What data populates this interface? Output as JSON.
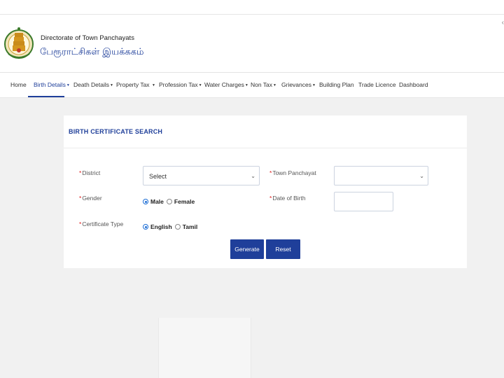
{
  "header": {
    "org_name_en": "Directorate of Town Panchayats",
    "org_name_ta": "பேரூராட்சிகள் இயக்ககம்",
    "corner_glyph": "‹"
  },
  "nav": {
    "items": [
      {
        "label": "Home",
        "dropdown": false
      },
      {
        "label": "Birth Details",
        "dropdown": true,
        "active": true
      },
      {
        "label": "Death Details",
        "dropdown": true
      },
      {
        "label": "Property Tax",
        "dropdown": true
      },
      {
        "label": "Profession Tax",
        "dropdown": true
      },
      {
        "label": "Water Charges",
        "dropdown": true
      },
      {
        "label": "Non Tax",
        "dropdown": true
      },
      {
        "label": "Grievances",
        "dropdown": true
      },
      {
        "label": "Building Plan",
        "dropdown": false
      },
      {
        "label": "Trade Licence",
        "dropdown": false
      },
      {
        "label": "Dashboard",
        "dropdown": false
      }
    ],
    "caret": "▼"
  },
  "form": {
    "title": "BIRTH CERTIFICATE SEARCH",
    "required_mark": "*",
    "district": {
      "label": "District",
      "value": "Select"
    },
    "town_panchayat": {
      "label": "Town Panchayat",
      "value": ""
    },
    "gender": {
      "label": "Gender",
      "options": [
        "Male",
        "Female"
      ],
      "selected": "Male"
    },
    "date_of_birth": {
      "label": "Date of Birth",
      "value": ""
    },
    "certificate_type": {
      "label": "Certificate Type",
      "options": [
        "English",
        "Tamil"
      ],
      "selected": "English"
    },
    "chevron": "⌄",
    "generate_label": "Generate",
    "reset_label": "Reset"
  },
  "colors": {
    "brand": "#1f3f9a",
    "required": "#e02020",
    "page_bg": "#f1f1f1",
    "radio_selected": "#1f6fd6"
  }
}
